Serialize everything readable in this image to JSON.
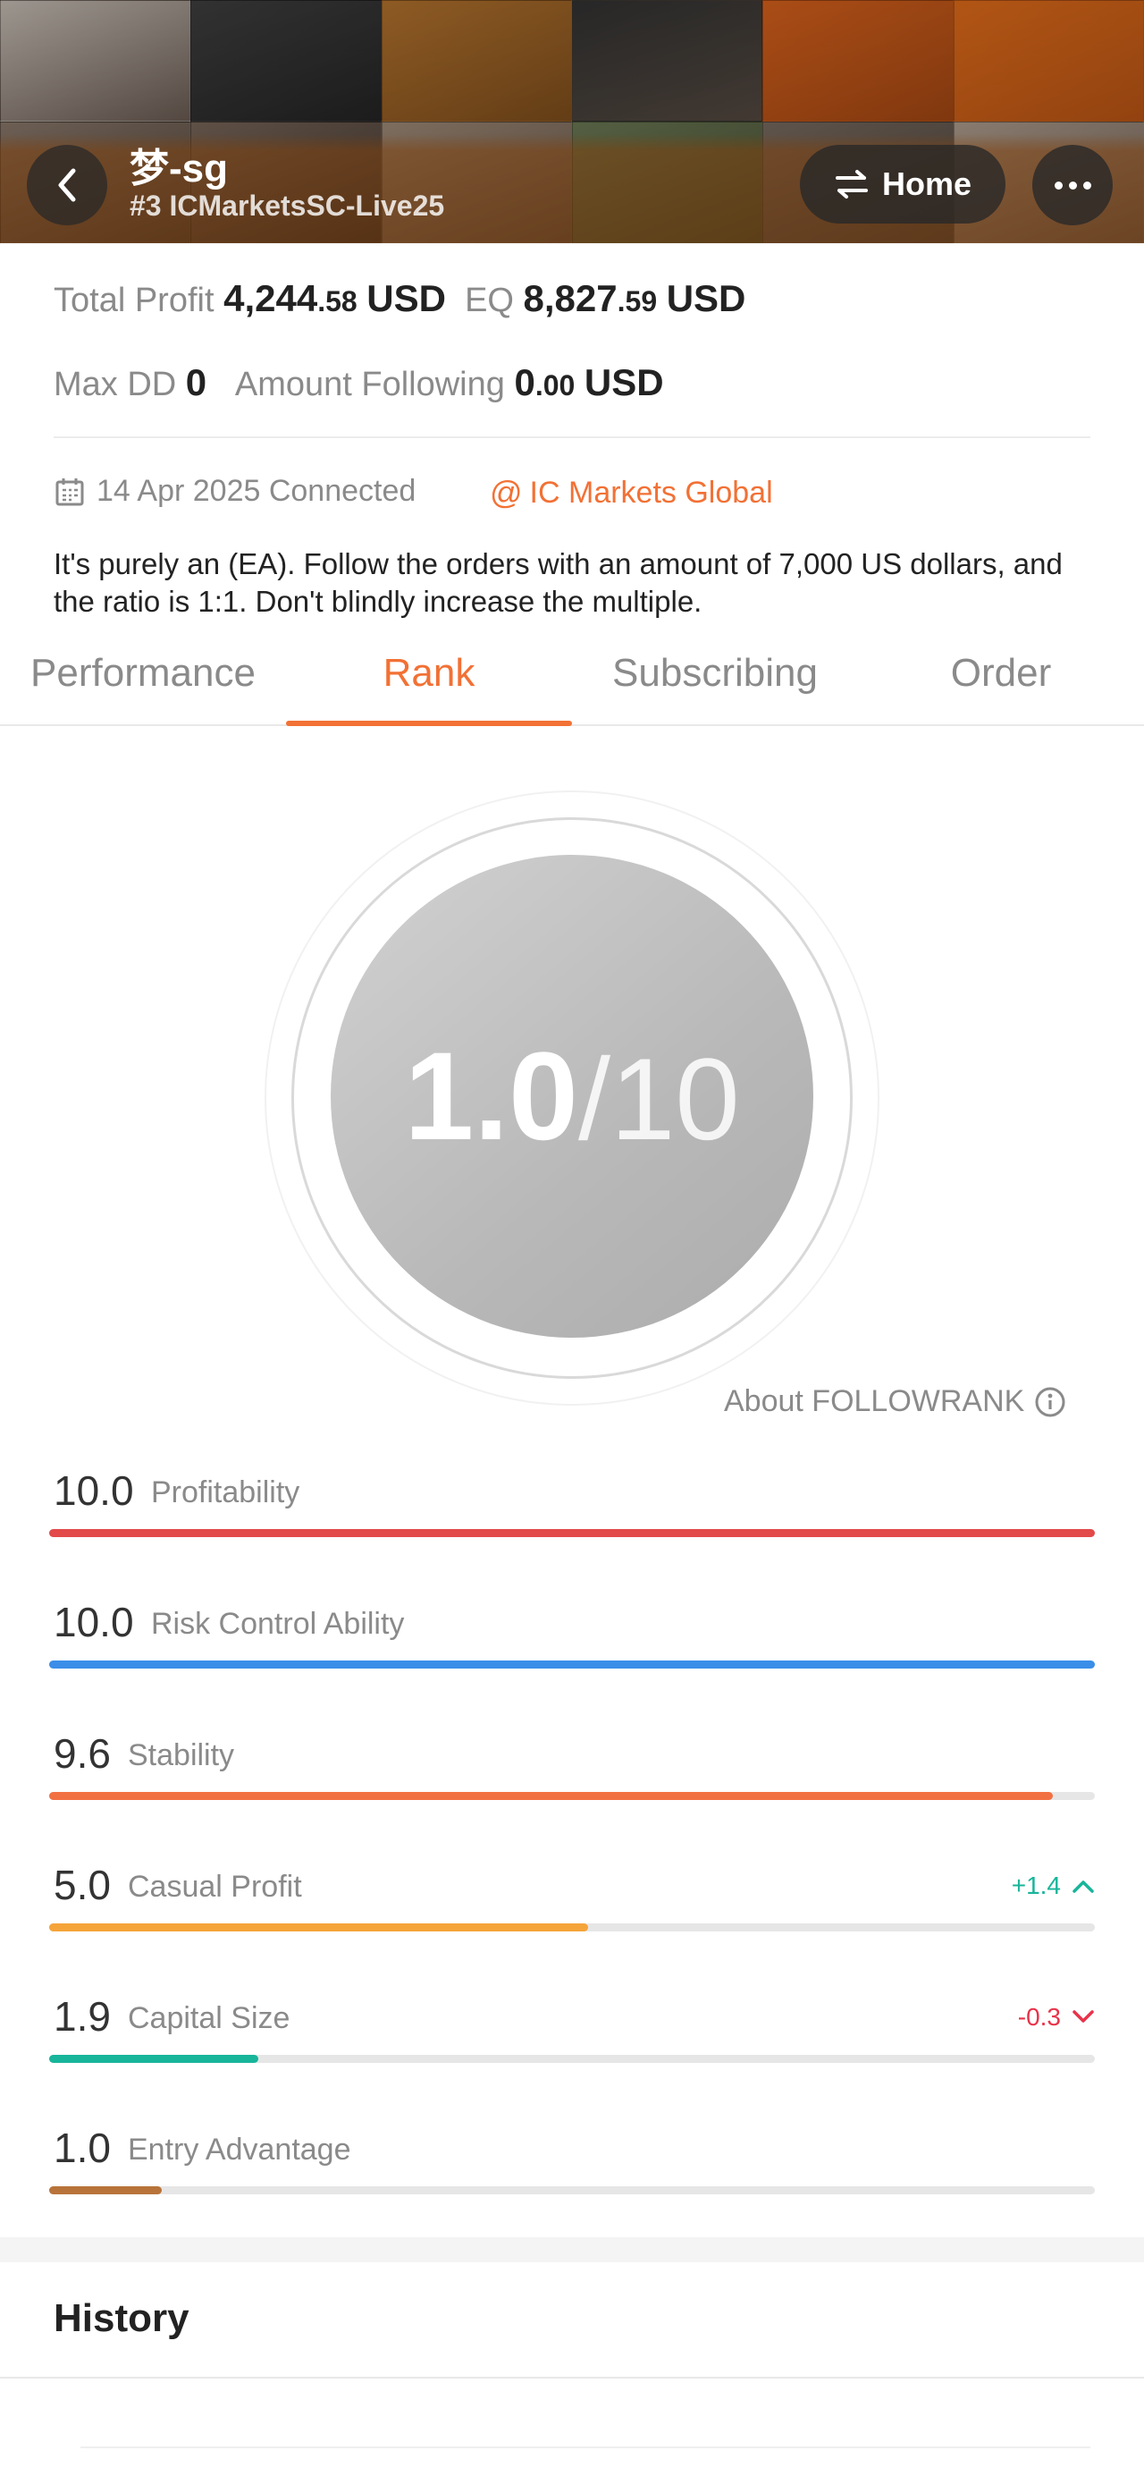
{
  "header": {
    "title": "梦-sg",
    "subtitle": "#3 ICMarketsSC-Live25",
    "home_label": "Home"
  },
  "stats": {
    "total_profit_label": "Total Profit",
    "total_profit_int": "4,244",
    "total_profit_dec": ".58",
    "total_profit_unit": "USD",
    "eq_label": "EQ",
    "eq_int": "8,827",
    "eq_dec": ".59",
    "eq_unit": "USD",
    "max_dd_label": "Max DD",
    "max_dd_value": "0",
    "amount_following_label": "Amount Following",
    "amount_following_int": "0",
    "amount_following_dec": ".00",
    "amount_following_unit": "USD"
  },
  "info": {
    "connected": "14 Apr 2025 Connected",
    "broker": "IC Markets Global",
    "description": "It's purely an (EA). Follow the orders with an amount of 7,000 US dollars, and the ratio is 1:1. Don't blindly increase the multiple."
  },
  "tabs": [
    {
      "label": "Performance"
    },
    {
      "label": "Rank"
    },
    {
      "label": "Subscribing"
    },
    {
      "label": "Order"
    }
  ],
  "active_tab": "Rank",
  "score": {
    "value": "1.0",
    "max": "/10"
  },
  "about_label": "About FOLLOWRANK",
  "metrics": [
    {
      "value": "10.0",
      "label": "Profitability",
      "fraction": 1.0,
      "color": "#e34a4a",
      "delta": ""
    },
    {
      "value": "10.0",
      "label": "Risk Control Ability",
      "fraction": 1.0,
      "color": "#3a8ee8",
      "delta": ""
    },
    {
      "value": "9.6",
      "label": "Stability",
      "fraction": 0.96,
      "color": "#f27142",
      "delta": ""
    },
    {
      "value": "5.0",
      "label": "Casual Profit",
      "fraction": 0.515,
      "color": "#f5a43a",
      "delta": "+1.4"
    },
    {
      "value": "1.9",
      "label": "Capital Size",
      "fraction": 0.2,
      "color": "#17b59a",
      "delta": "-0.3"
    },
    {
      "value": "1.0",
      "label": "Entry Advantage",
      "fraction": 0.108,
      "color": "#b8733a",
      "delta": ""
    }
  ],
  "history_title": "History",
  "colors": {
    "accent": "#f27135",
    "up": "#17b59a",
    "down": "#e8334a"
  }
}
